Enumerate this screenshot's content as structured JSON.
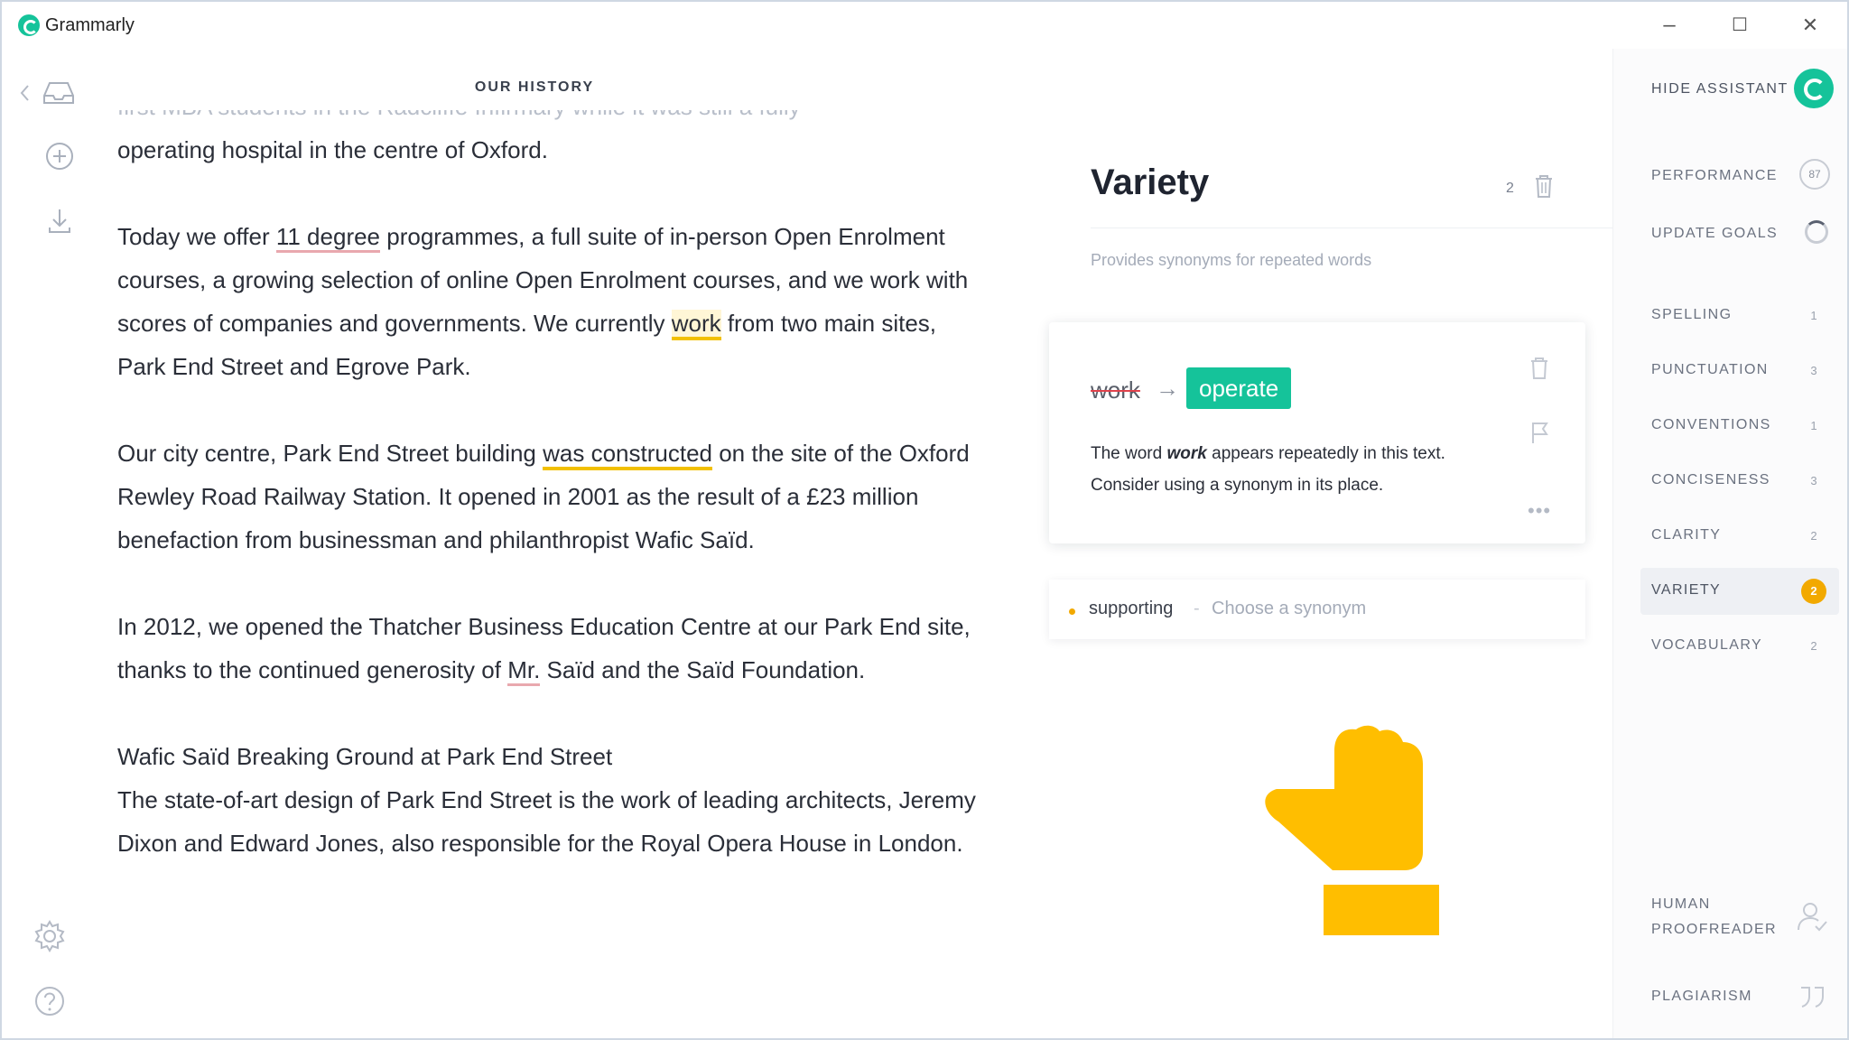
{
  "app": {
    "title": "Grammarly",
    "window_controls": {
      "minimize": "–",
      "maximize": "☐",
      "close": "✕"
    }
  },
  "document": {
    "title": "OUR HISTORY",
    "paragraphs": [
      {
        "faded_line": "first MBA students in the Radcliffe Infirmary while it was still a fully",
        "text": "operating hospital in the centre of Oxford."
      },
      {
        "t1": "Today we offer ",
        "flag1": "11 degree",
        "t2": " programmes, a full suite of in-person Open Enrolment courses, a growing selection of online Open Enrolment courses, and we work with scores of companies and governments.  We currently ",
        "flag2": "work",
        "t3": " from two main sites, Park End Street and Egrove Park."
      },
      {
        "t1": "Our city centre, Park End Street building ",
        "flag1": "was constructed",
        "t2": " on the site of the Oxford Rewley Road Railway Station. It opened in 2001 as the result of a £23 million benefaction from businessman and philanthropist Wafic Saïd."
      },
      {
        "t1": "In 2012, we opened the Thatcher Business Education Centre at our Park End site, thanks to the continued generosity of ",
        "flag1": "Mr.",
        "t2": " Saïd and the Saïd Foundation."
      },
      {
        "heading": " Wafic Saïd Breaking Ground at Park End Street",
        "text": "The state-of-art design of Park End Street is the work of leading architects, Jeremy Dixon and Edward Jones, also responsible for the Royal Opera House in London."
      }
    ]
  },
  "suggestion_panel": {
    "category_title": "Variety",
    "count": "2",
    "description": "Provides synonyms for repeated words",
    "card": {
      "original_word": "work",
      "arrow": "→",
      "replacement": "operate",
      "explanation_pre": "The word ",
      "explanation_word": "work",
      "explanation_post": " appears repeatedly in this text. Consider using a synonym in its place.",
      "more": "•••"
    },
    "collapsed_item": {
      "word": "supporting",
      "separator": "-",
      "hint": "Choose a synonym"
    }
  },
  "sidebar": {
    "hide_assistant": "HIDE ASSISTANT",
    "performance": {
      "label": "PERFORMANCE",
      "score": "87"
    },
    "update_goals": "UPDATE GOALS",
    "categories": [
      {
        "label": "SPELLING",
        "count": "1"
      },
      {
        "label": "PUNCTUATION",
        "count": "3"
      },
      {
        "label": "CONVENTIONS",
        "count": "1"
      },
      {
        "label": "CONCISENESS",
        "count": "3"
      },
      {
        "label": "CLARITY",
        "count": "2"
      },
      {
        "label": "VARIETY",
        "count": "2"
      },
      {
        "label": "VOCABULARY",
        "count": "2"
      }
    ],
    "human_proofreader": "HUMAN PROOFREADER",
    "plagiarism": "PLAGIARISM"
  },
  "colors": {
    "accent": "#15c39a",
    "variety_badge": "#f2a900",
    "cursor_hand": "#ffbe00"
  }
}
